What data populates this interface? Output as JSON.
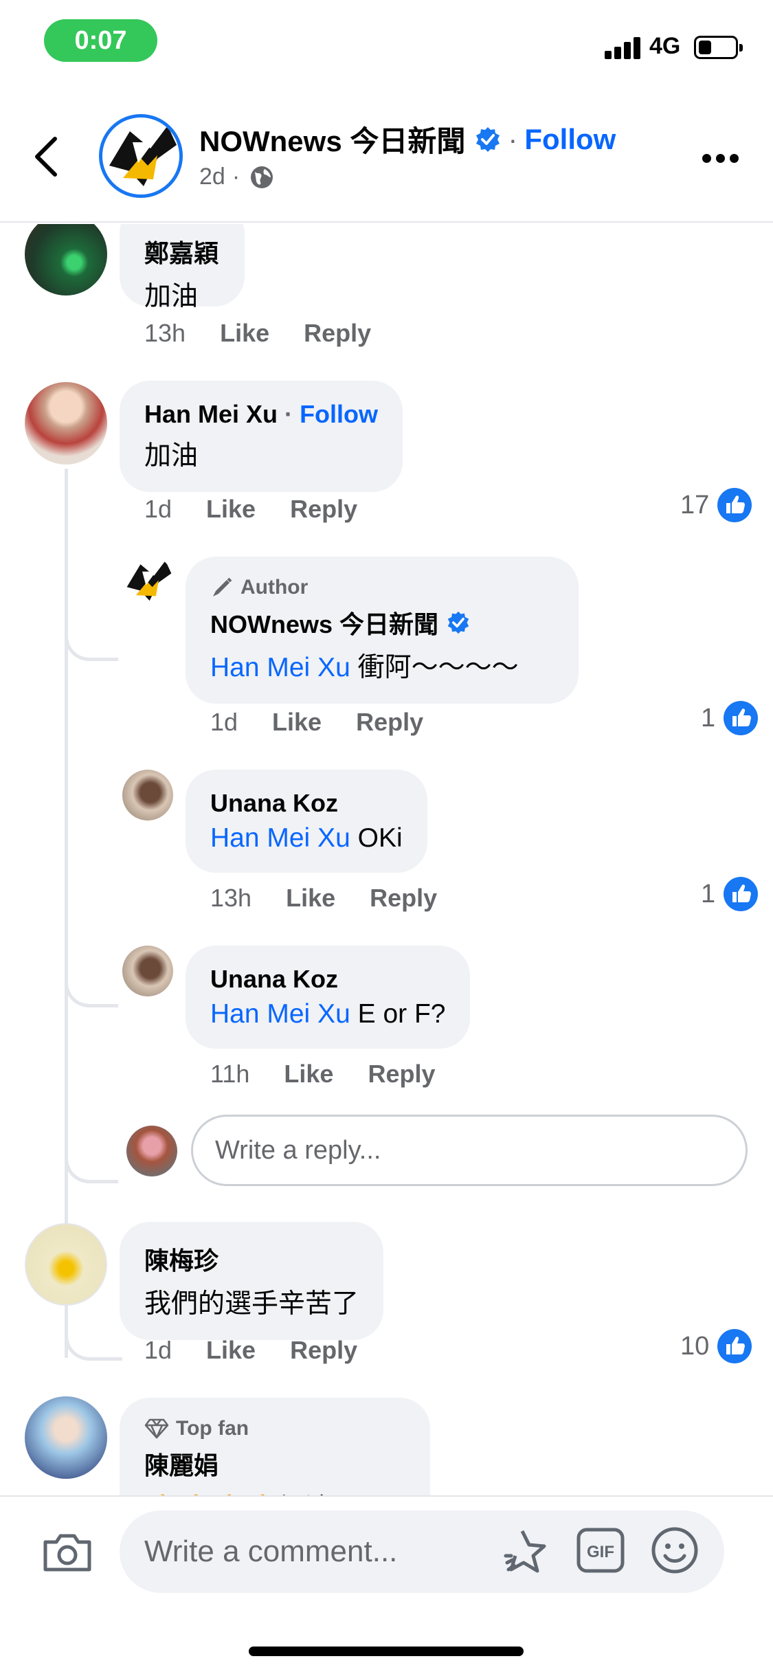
{
  "status_bar": {
    "time": "0:07",
    "network": "4G",
    "battery_level": 0.3
  },
  "header": {
    "page_name": "NOWnews 今日新聞",
    "separator": "·",
    "follow_label": "Follow",
    "age": "2d",
    "dot": "·"
  },
  "comments": [
    {
      "name": "鄭嘉穎",
      "text": "加油",
      "time": "13h",
      "like": "Like",
      "reply": "Reply"
    },
    {
      "name": "Han Mei Xu",
      "follow_sep": "·",
      "follow": "Follow",
      "text": "加油",
      "time": "1d",
      "like": "Like",
      "reply": "Reply",
      "likes": "17",
      "replies": [
        {
          "badge": "Author",
          "name": "NOWnews 今日新聞",
          "mention": "Han Mei Xu",
          "text": "衝阿～～～～",
          "time": "1d",
          "like": "Like",
          "reply": "Reply",
          "likes": "1"
        },
        {
          "name": "Unana Koz",
          "mention": "Han Mei Xu",
          "text": "OKi",
          "time": "13h",
          "like": "Like",
          "reply": "Reply",
          "likes": "1"
        },
        {
          "name": "Unana Koz",
          "mention": "Han Mei Xu",
          "text": "E or F?",
          "time": "11h",
          "like": "Like",
          "reply": "Reply"
        }
      ],
      "reply_placeholder": "Write a reply..."
    },
    {
      "name": "陳梅珍",
      "text": "我們的選手辛苦了",
      "time": "1d",
      "like": "Like",
      "reply": "Reply",
      "likes": "10"
    },
    {
      "badge": "Top fan",
      "name": "陳麗娟",
      "text": "👍👍👍👍加油！"
    }
  ],
  "composer": {
    "placeholder": "Write a comment..."
  },
  "colors": {
    "brand_blue": "#0866ff",
    "bubble": "#f0f2f5",
    "status_green": "#34c759"
  },
  "icons": [
    "back-chevron-icon",
    "verified-icon",
    "globe-icon",
    "more-icon",
    "like-icon",
    "pencil-icon",
    "diamond-icon",
    "camera-icon",
    "sticker-icon",
    "gif-icon",
    "emoji-icon"
  ]
}
